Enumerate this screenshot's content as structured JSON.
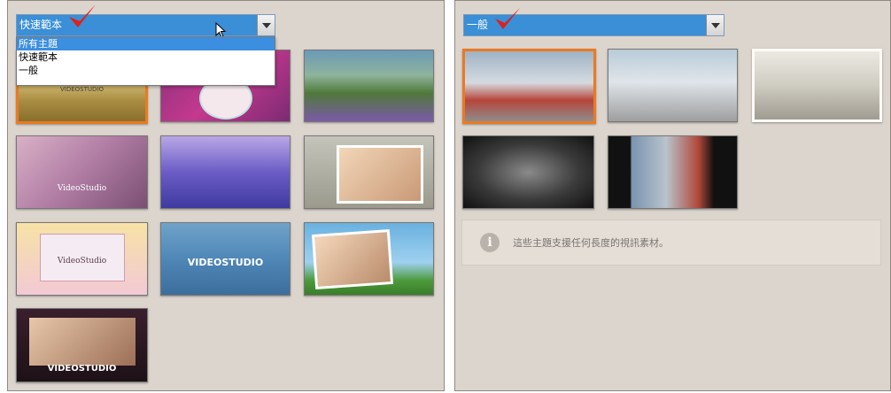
{
  "left_panel": {
    "combo_value": "快速範本",
    "dropdown_options": [
      "所有主題",
      "快速範本",
      "一般"
    ],
    "dropdown_selected_index": 0,
    "thumbnails": [
      {
        "name": "thumb-studio-field",
        "text": "VIDEOSTUDIO"
      },
      {
        "name": "thumb-birthday-cake",
        "text": ""
      },
      {
        "name": "thumb-lavender-landscape",
        "text": ""
      },
      {
        "name": "thumb-wedding-couple",
        "text": "VideoStudio"
      },
      {
        "name": "thumb-kids-mosaic",
        "text": ""
      },
      {
        "name": "thumb-family-photo",
        "text": ""
      },
      {
        "name": "thumb-pink-roses",
        "text": "VideoStudio"
      },
      {
        "name": "thumb-blue-tiles",
        "text": "VIDEOSTUDIO"
      },
      {
        "name": "thumb-mother-child",
        "text": ""
      },
      {
        "name": "thumb-two-women",
        "text": "VIDEOSTUDIO"
      }
    ]
  },
  "right_panel": {
    "combo_value": "一般",
    "thumbnails": [
      {
        "name": "thumb-van-1",
        "selected": true
      },
      {
        "name": "thumb-van-2",
        "selected": false
      },
      {
        "name": "thumb-van-3",
        "selected": false
      },
      {
        "name": "thumb-van-4",
        "selected": false
      },
      {
        "name": "thumb-van-5",
        "selected": false
      }
    ],
    "info_text": "這些主題支援任何長度的視訊素材。"
  },
  "colors": {
    "panel_bg": "#dcd5cd",
    "combo_bg": "#3a8fd6",
    "selection_border": "#ea7a22",
    "check_mark": "#e0201a"
  }
}
